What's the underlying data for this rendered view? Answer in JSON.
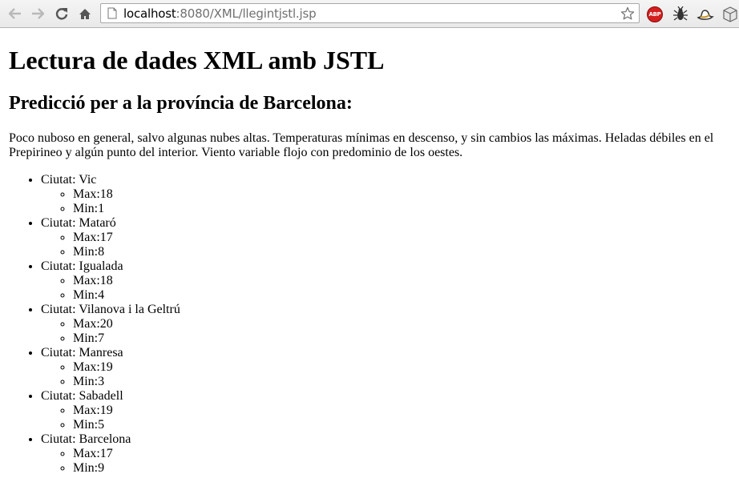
{
  "browser": {
    "url_host": "localhost",
    "url_path": ":8080/XML/llegintjstl.jsp",
    "extensions": [
      {
        "name": "adblock-plus",
        "label": "ABP"
      },
      {
        "name": "bug"
      },
      {
        "name": "hat"
      },
      {
        "name": "cube"
      }
    ]
  },
  "page": {
    "title": "Lectura de dades XML amb JSTL",
    "subtitle": "Predicció per a la província de Barcelona:",
    "forecast": "Poco nuboso en general, salvo algunas nubes altas. Temperaturas mínimas en descenso, y sin cambios las máximas. Heladas débiles en el Prepirineo y algún punto del interior. Viento variable flojo con predominio de los oestes.",
    "cities": [
      {
        "label": "Ciutat: Vic",
        "max": "Max:18",
        "min": "Min:1"
      },
      {
        "label": "Ciutat: Mataró",
        "max": "Max:17",
        "min": "Min:8"
      },
      {
        "label": "Ciutat: Igualada",
        "max": "Max:18",
        "min": "Min:4"
      },
      {
        "label": "Ciutat: Vilanova i la Geltrú",
        "max": "Max:20",
        "min": "Min:7"
      },
      {
        "label": "Ciutat: Manresa",
        "max": "Max:19",
        "min": "Min:3"
      },
      {
        "label": "Ciutat: Sabadell",
        "max": "Max:19",
        "min": "Min:5"
      },
      {
        "label": "Ciutat: Barcelona",
        "max": "Max:17",
        "min": "Min:9"
      }
    ]
  }
}
